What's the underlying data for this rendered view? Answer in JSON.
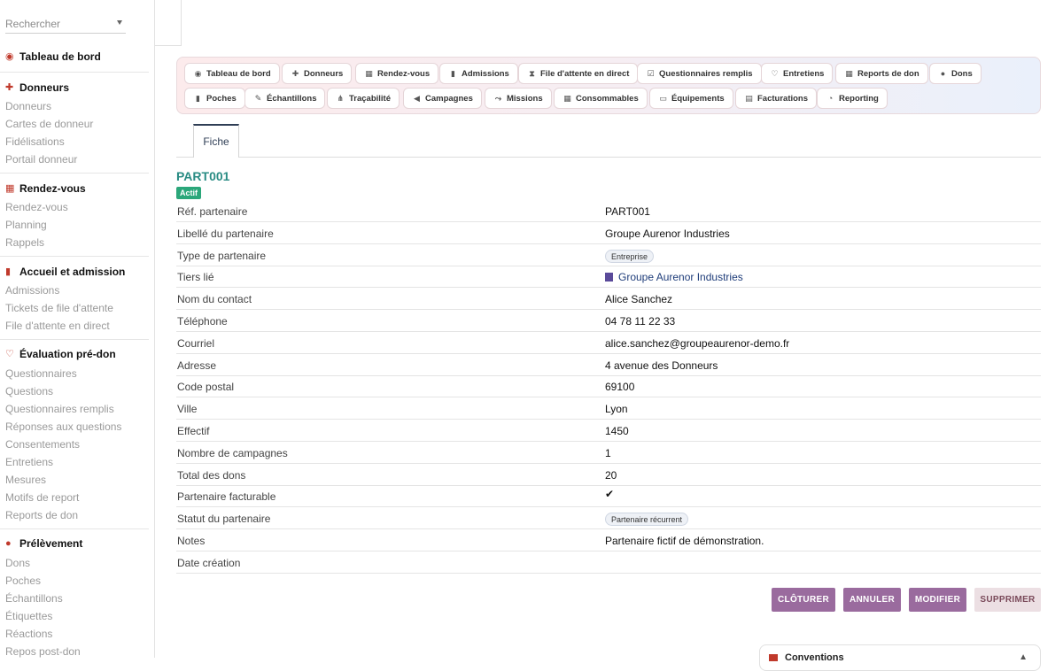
{
  "sidebar": {
    "search_placeholder": "Rechercher",
    "sections": [
      {
        "title": "Tableau de bord",
        "icon": "gauge-icon",
        "items": []
      },
      {
        "title": "Donneurs",
        "icon": "user-plus-icon",
        "items": [
          "Donneurs",
          "Cartes de donneur",
          "Fidélisations",
          "Portail donneur"
        ]
      },
      {
        "title": "Rendez-vous",
        "icon": "calendar-icon",
        "items": [
          "Rendez-vous",
          "Planning",
          "Rappels"
        ]
      },
      {
        "title": "Accueil et admission",
        "icon": "clipboard-icon",
        "items": [
          "Admissions",
          "Tickets de file d'attente",
          "File d'attente en direct"
        ]
      },
      {
        "title": "Évaluation pré-don",
        "icon": "stethoscope-icon",
        "items": [
          "Questionnaires",
          "Questions",
          "Questionnaires remplis",
          "Réponses aux questions",
          "Consentements",
          "Entretiens",
          "Mesures",
          "Motifs de report",
          "Reports de don"
        ]
      },
      {
        "title": "Prélèvement",
        "icon": "drop-icon",
        "items": [
          "Dons",
          "Poches",
          "Échantillons",
          "Étiquettes",
          "Réactions",
          "Repos post-don"
        ]
      }
    ]
  },
  "nav": {
    "row1": [
      {
        "label": "Tableau de bord",
        "icon": "gauge-icon"
      },
      {
        "label": "Donneurs",
        "icon": "user-plus-icon"
      },
      {
        "label": "Rendez-vous",
        "icon": "calendar-icon"
      },
      {
        "label": "Admissions",
        "icon": "clipboard-icon"
      },
      {
        "label": "File d'attente en direct",
        "icon": "hourglass-icon"
      },
      {
        "label": "Questionnaires remplis",
        "icon": "checklist-icon"
      },
      {
        "label": "Entretiens",
        "icon": "stethoscope-icon"
      },
      {
        "label": "Reports de don",
        "icon": "calendar-x-icon"
      },
      {
        "label": "Dons",
        "icon": "drop-icon"
      }
    ],
    "row2": [
      {
        "label": "Poches",
        "icon": "bag-icon"
      },
      {
        "label": "Échantillons",
        "icon": "pipette-icon"
      },
      {
        "label": "Traçabilité",
        "icon": "network-icon"
      },
      {
        "label": "Campagnes",
        "icon": "megaphone-icon"
      },
      {
        "label": "Missions",
        "icon": "route-icon"
      },
      {
        "label": "Consommables",
        "icon": "boxes-icon"
      },
      {
        "label": "Équipements",
        "icon": "monitor-icon"
      },
      {
        "label": "Facturations",
        "icon": "invoice-icon"
      },
      {
        "label": "Reporting",
        "icon": "pie-chart-icon"
      }
    ]
  },
  "tabs": {
    "active": "Fiche"
  },
  "record": {
    "title": "PART001",
    "status_badge": "Actif",
    "fields": [
      {
        "label": "Réf. partenaire",
        "value": "PART001"
      },
      {
        "label": "Libellé du partenaire",
        "value": "Groupe Aurenor Industries"
      },
      {
        "label": "Type de partenaire",
        "value": "Entreprise"
      },
      {
        "label": "Tiers lié",
        "value": "Groupe Aurenor Industries"
      },
      {
        "label": "Nom du contact",
        "value": "Alice Sanchez"
      },
      {
        "label": "Téléphone",
        "value": "04 78 11 22 33"
      },
      {
        "label": "Courriel",
        "value": "alice.sanchez@groupeaurenor-demo.fr"
      },
      {
        "label": "Adresse",
        "value": "4 avenue des Donneurs"
      },
      {
        "label": "Code postal",
        "value": "69100"
      },
      {
        "label": "Ville",
        "value": "Lyon"
      },
      {
        "label": "Effectif",
        "value": "1450"
      },
      {
        "label": "Nombre de campagnes",
        "value": "1"
      },
      {
        "label": "Total des dons",
        "value": "20"
      },
      {
        "label": "Partenaire facturable",
        "value": "✔"
      },
      {
        "label": "Statut du partenaire",
        "value": "Partenaire récurrent"
      },
      {
        "label": "Notes",
        "value": "Partenaire fictif de démonstration."
      },
      {
        "label": "Date création",
        "value": ""
      }
    ]
  },
  "actions": {
    "close_label": "CLÔTURER",
    "cancel_label": "ANNULER",
    "edit_label": "MODIFIER",
    "delete_label": "SUPPRIMER"
  },
  "bottom_card": {
    "title": "Conventions"
  },
  "colors": {
    "accent": "#2a8c84",
    "primary_button": "#9a6b9e",
    "status_green": "#2ba77a",
    "section_icon": "#c0392b"
  }
}
